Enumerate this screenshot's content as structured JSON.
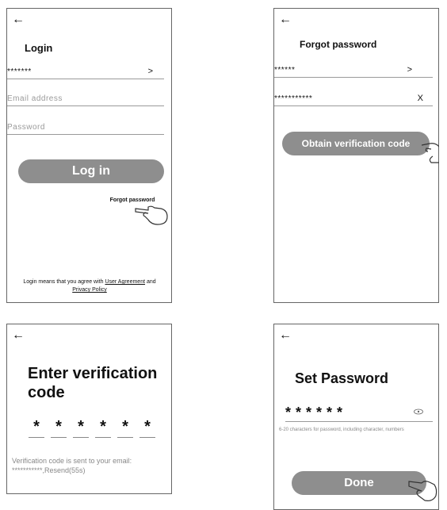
{
  "login": {
    "title": "Login",
    "account_value": "*******",
    "account_trailing": ">",
    "email_placeholder": "Email address",
    "password_placeholder": "Password",
    "login_button": "Log in",
    "forgot_link": "Forgot password",
    "agreement_prefix": "Login means that you agree with ",
    "agreement_link": "User Agreement",
    "agreement_and": " and",
    "privacy_link": "Privacy Policy"
  },
  "forgot": {
    "title": "Forgot password",
    "account_value": "******",
    "account_trailing": ">",
    "email_value": "***********",
    "clear_label": "X",
    "obtain_button": "Obtain verification code"
  },
  "verify": {
    "title_line1": "Enter verification",
    "title_line2": "code",
    "digits": [
      "*",
      "*",
      "*",
      "*",
      "*",
      "*"
    ],
    "sent_text": "Verification code is sent to your email:",
    "resend_text": "***********,Resend(55s)"
  },
  "setpw": {
    "title": "Set Password",
    "password_value": "* * * * * *",
    "hint": "6-20 characters for password, including character, numbers",
    "done_button": "Done"
  },
  "icons": {
    "back": "back-arrow-icon",
    "pointer": "pointing-hand-icon",
    "eye": "eye-icon"
  }
}
